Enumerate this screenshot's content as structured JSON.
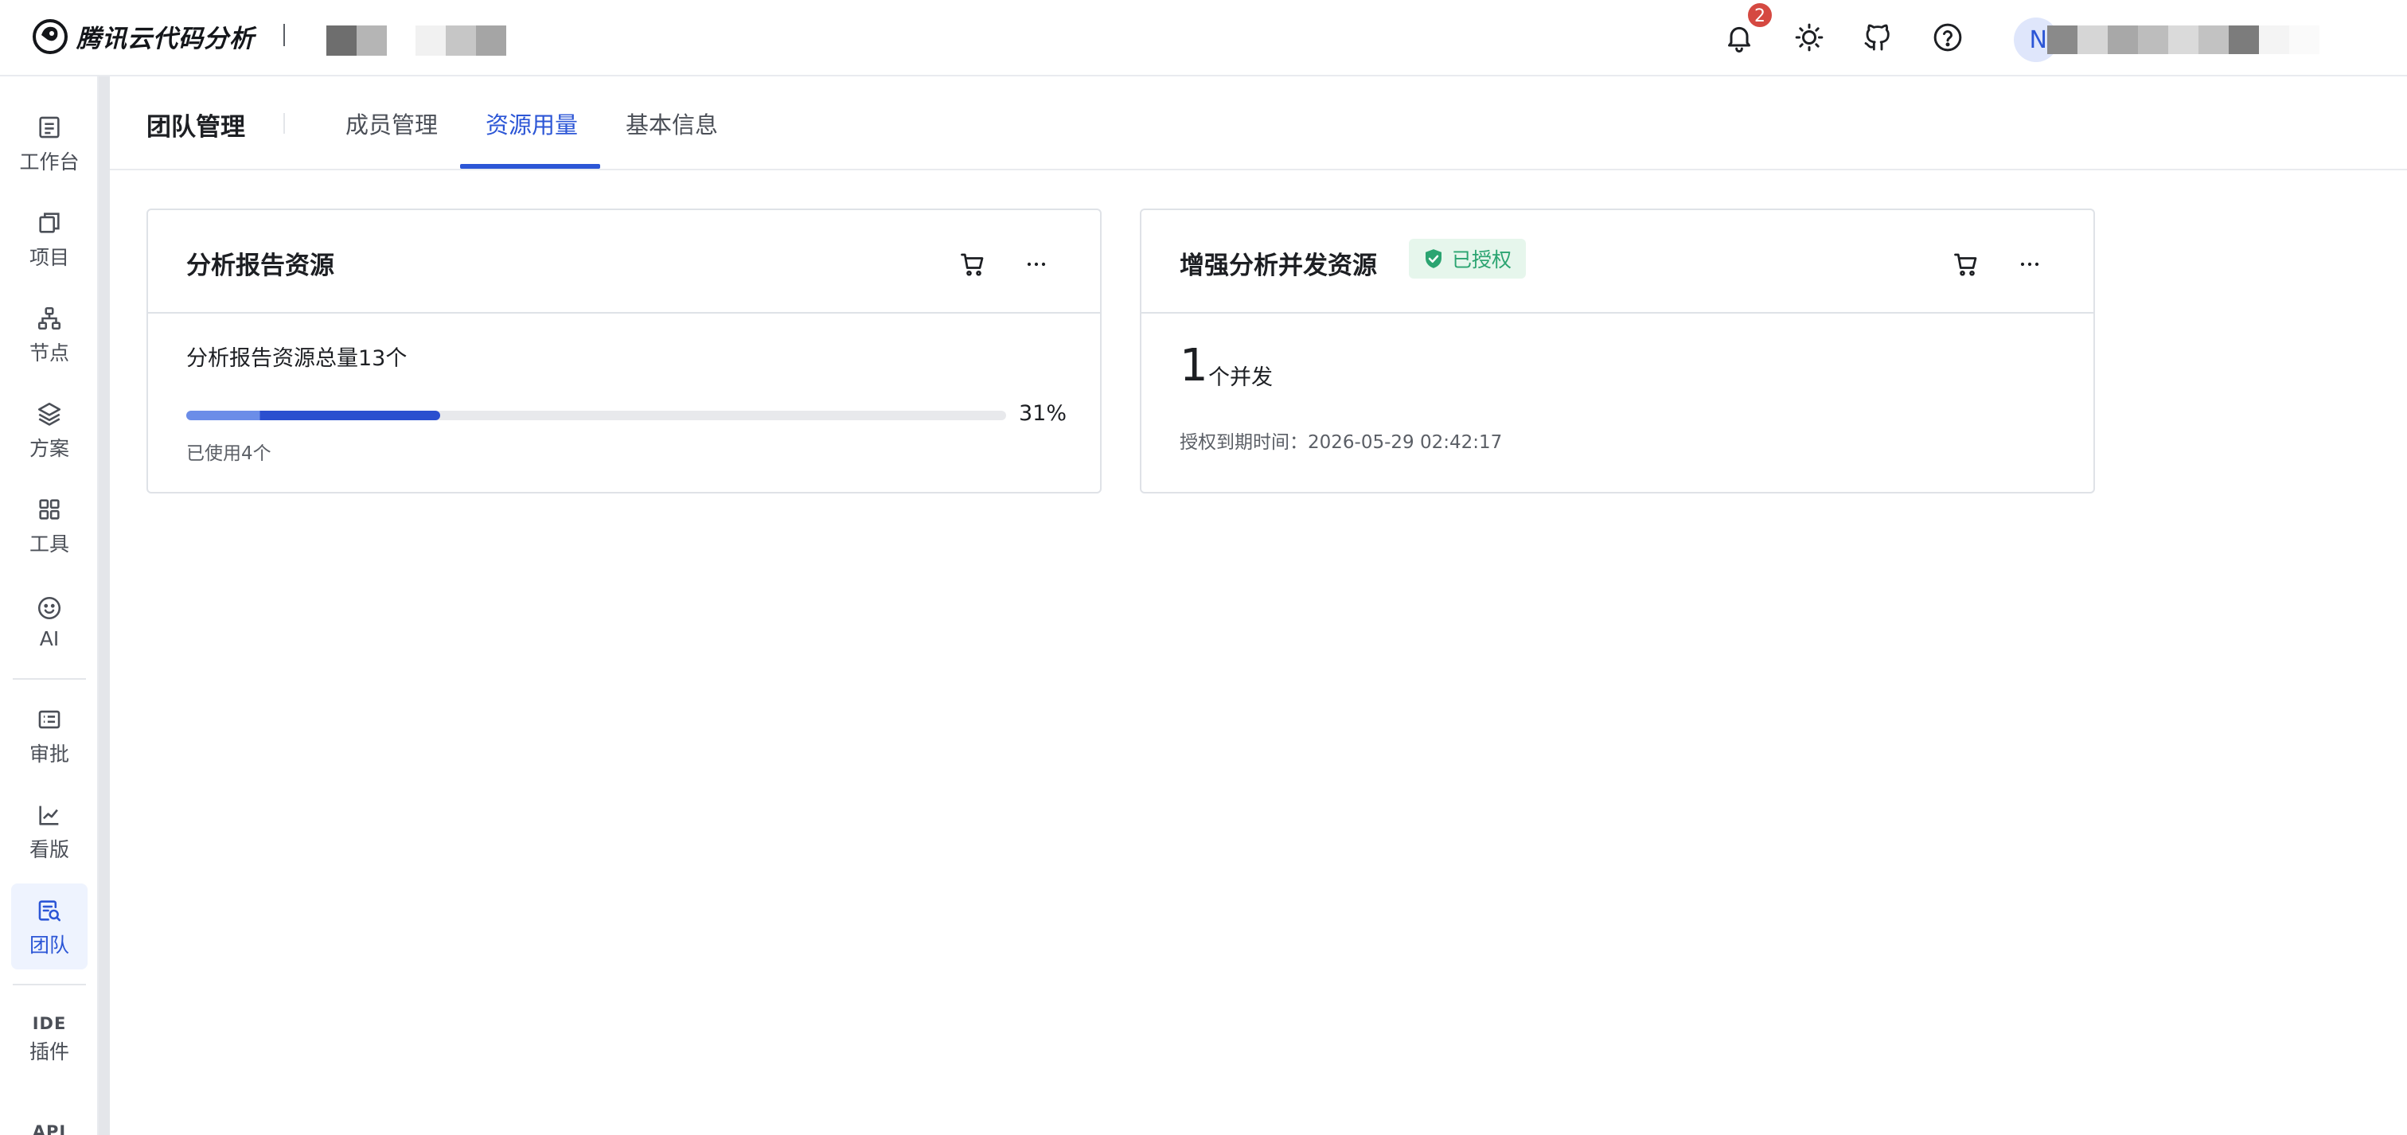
{
  "header": {
    "app_name": "腾讯云代码分析",
    "notification_count": "2",
    "user_initial": "N",
    "icons": [
      "bell-icon",
      "theme-sun-icon",
      "github-icon",
      "help-icon"
    ]
  },
  "sidebar": {
    "items": [
      {
        "label": "工作台",
        "icon": "workbench-icon"
      },
      {
        "label": "项目",
        "icon": "project-icon"
      },
      {
        "label": "节点",
        "icon": "node-icon"
      },
      {
        "label": "方案",
        "icon": "scheme-layers-icon"
      },
      {
        "label": "工具",
        "icon": "tools-grid-icon"
      },
      {
        "label": "AI",
        "icon": "ai-smile-icon"
      },
      {
        "label": "审批",
        "icon": "approval-list-icon"
      },
      {
        "label": "看版",
        "icon": "dashboard-chart-icon"
      },
      {
        "label": "团队",
        "icon": "team-search-icon",
        "active": true
      },
      {
        "label": "插件",
        "top_label": "IDE"
      },
      {
        "label": "",
        "top_label": "API"
      }
    ]
  },
  "page": {
    "title": "团队管理",
    "tabs": [
      {
        "label": "成员管理",
        "active": false
      },
      {
        "label": "资源用量",
        "active": true
      },
      {
        "label": "基本信息",
        "active": false
      }
    ]
  },
  "cards": {
    "report": {
      "title": "分析报告资源",
      "total_text": "分析报告资源总量13个",
      "used_percent": 31,
      "percent_text": "31%",
      "used_text": "已使用4个"
    },
    "concurrency": {
      "title": "增强分析并发资源",
      "badge": "已授权",
      "count": "1",
      "unit": "个并发",
      "expiry_text": "授权到期时间：2026-05-29 02:42:17"
    }
  },
  "colors": {
    "accent": "#2c56d6",
    "badge_bg": "#e6f6ec",
    "badge_text": "#2ba471",
    "notification": "#d54941"
  }
}
